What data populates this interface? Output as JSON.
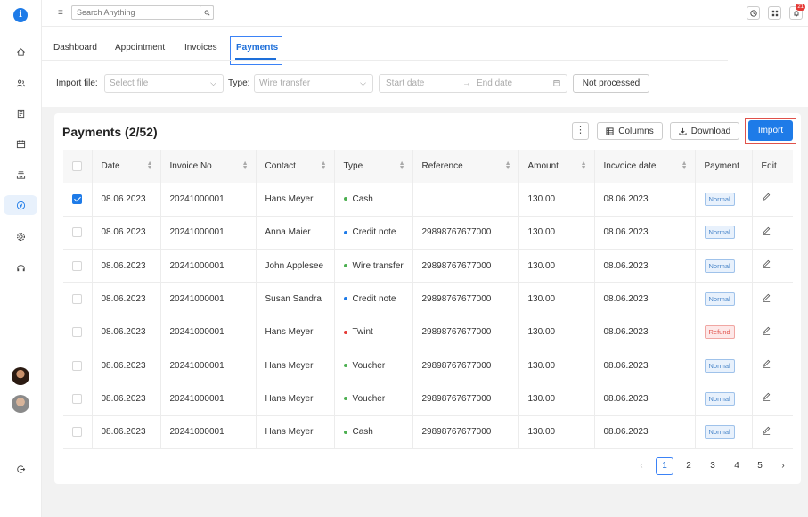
{
  "sidebar": {
    "logo": "i",
    "icons": [
      "home-icon",
      "users-icon",
      "document-icon",
      "calendar-icon",
      "inbox-icon",
      "payments-icon",
      "settings-icon",
      "headphones-icon"
    ],
    "active": "payments-icon",
    "logout_icon": "logout-icon"
  },
  "topbar": {
    "menu_icon": "≡",
    "search_placeholder": "Search Anything",
    "notification_count": "21"
  },
  "tabs": [
    {
      "label": "Dashboard"
    },
    {
      "label": "Appointment"
    },
    {
      "label": "Invoices"
    },
    {
      "label": "Payments",
      "active": true
    }
  ],
  "filters": {
    "import_file_label": "Import file:",
    "import_file_placeholder": "Select file",
    "type_label": "Type:",
    "type_value": "Wire transfer",
    "start_date_placeholder": "Start date",
    "date_separator": "→",
    "end_date_placeholder": "End date",
    "not_processed_label": "Not processed"
  },
  "card": {
    "title": "Payments (2/52)",
    "kebab": "⋮",
    "columns_label": "Columns",
    "download_label": "Download",
    "import_label": "Import"
  },
  "table": {
    "headers": {
      "date": "Date",
      "invoice_no": "Invoice No",
      "contact": "Contact",
      "type": "Type",
      "reference": "Reference",
      "amount": "Amount",
      "invoice_date": "Incvoice date",
      "payment": "Payment",
      "edit": "Edit"
    },
    "rows": [
      {
        "checked": true,
        "date": "08.06.2023",
        "invoice_no": "20241000001",
        "contact": "Hans Meyer",
        "type": "Cash",
        "type_color": "#4caf50",
        "reference": "",
        "amount": "130.00",
        "invoice_date": "08.06.2023",
        "payment": "Normal",
        "payment_kind": "normal"
      },
      {
        "checked": false,
        "date": "08.06.2023",
        "invoice_no": "20241000001",
        "contact": "Anna Maier",
        "type": "Credit note",
        "type_color": "#1e7be8",
        "reference": "29898767677000",
        "amount": "130.00",
        "invoice_date": "08.06.2023",
        "payment": "Normal",
        "payment_kind": "normal"
      },
      {
        "checked": false,
        "date": "08.06.2023",
        "invoice_no": "20241000001",
        "contact": "John Applesee",
        "type": "Wire transfer",
        "type_color": "#4caf50",
        "reference": "29898767677000",
        "amount": "130.00",
        "invoice_date": "08.06.2023",
        "payment": "Normal",
        "payment_kind": "normal"
      },
      {
        "checked": false,
        "date": "08.06.2023",
        "invoice_no": "20241000001",
        "contact": "Susan Sandra",
        "type": "Credit note",
        "type_color": "#1e7be8",
        "reference": "29898767677000",
        "amount": "130.00",
        "invoice_date": "08.06.2023",
        "payment": "Normal",
        "payment_kind": "normal"
      },
      {
        "checked": false,
        "date": "08.06.2023",
        "invoice_no": "20241000001",
        "contact": "Hans Meyer",
        "type": "Twint",
        "type_color": "#e53935",
        "reference": "29898767677000",
        "amount": "130.00",
        "invoice_date": "08.06.2023",
        "payment": "Refund",
        "payment_kind": "refund"
      },
      {
        "checked": false,
        "date": "08.06.2023",
        "invoice_no": "20241000001",
        "contact": "Hans Meyer",
        "type": "Voucher",
        "type_color": "#4caf50",
        "reference": "29898767677000",
        "amount": "130.00",
        "invoice_date": "08.06.2023",
        "payment": "Normal",
        "payment_kind": "normal"
      },
      {
        "checked": false,
        "date": "08.06.2023",
        "invoice_no": "20241000001",
        "contact": "Hans Meyer",
        "type": "Voucher",
        "type_color": "#4caf50",
        "reference": "29898767677000",
        "amount": "130.00",
        "invoice_date": "08.06.2023",
        "payment": "Normal",
        "payment_kind": "normal"
      },
      {
        "checked": false,
        "date": "08.06.2023",
        "invoice_no": "20241000001",
        "contact": "Hans Meyer",
        "type": "Cash",
        "type_color": "#4caf50",
        "reference": "29898767677000",
        "amount": "130.00",
        "invoice_date": "08.06.2023",
        "payment": "Normal",
        "payment_kind": "normal"
      }
    ]
  },
  "pagination": {
    "prev": "‹",
    "pages": [
      "1",
      "2",
      "3",
      "4",
      "5"
    ],
    "current": "1",
    "next": "›"
  },
  "colors": {
    "accent": "#1e7be8",
    "refund": "#e53935",
    "positive": "#4caf50"
  }
}
